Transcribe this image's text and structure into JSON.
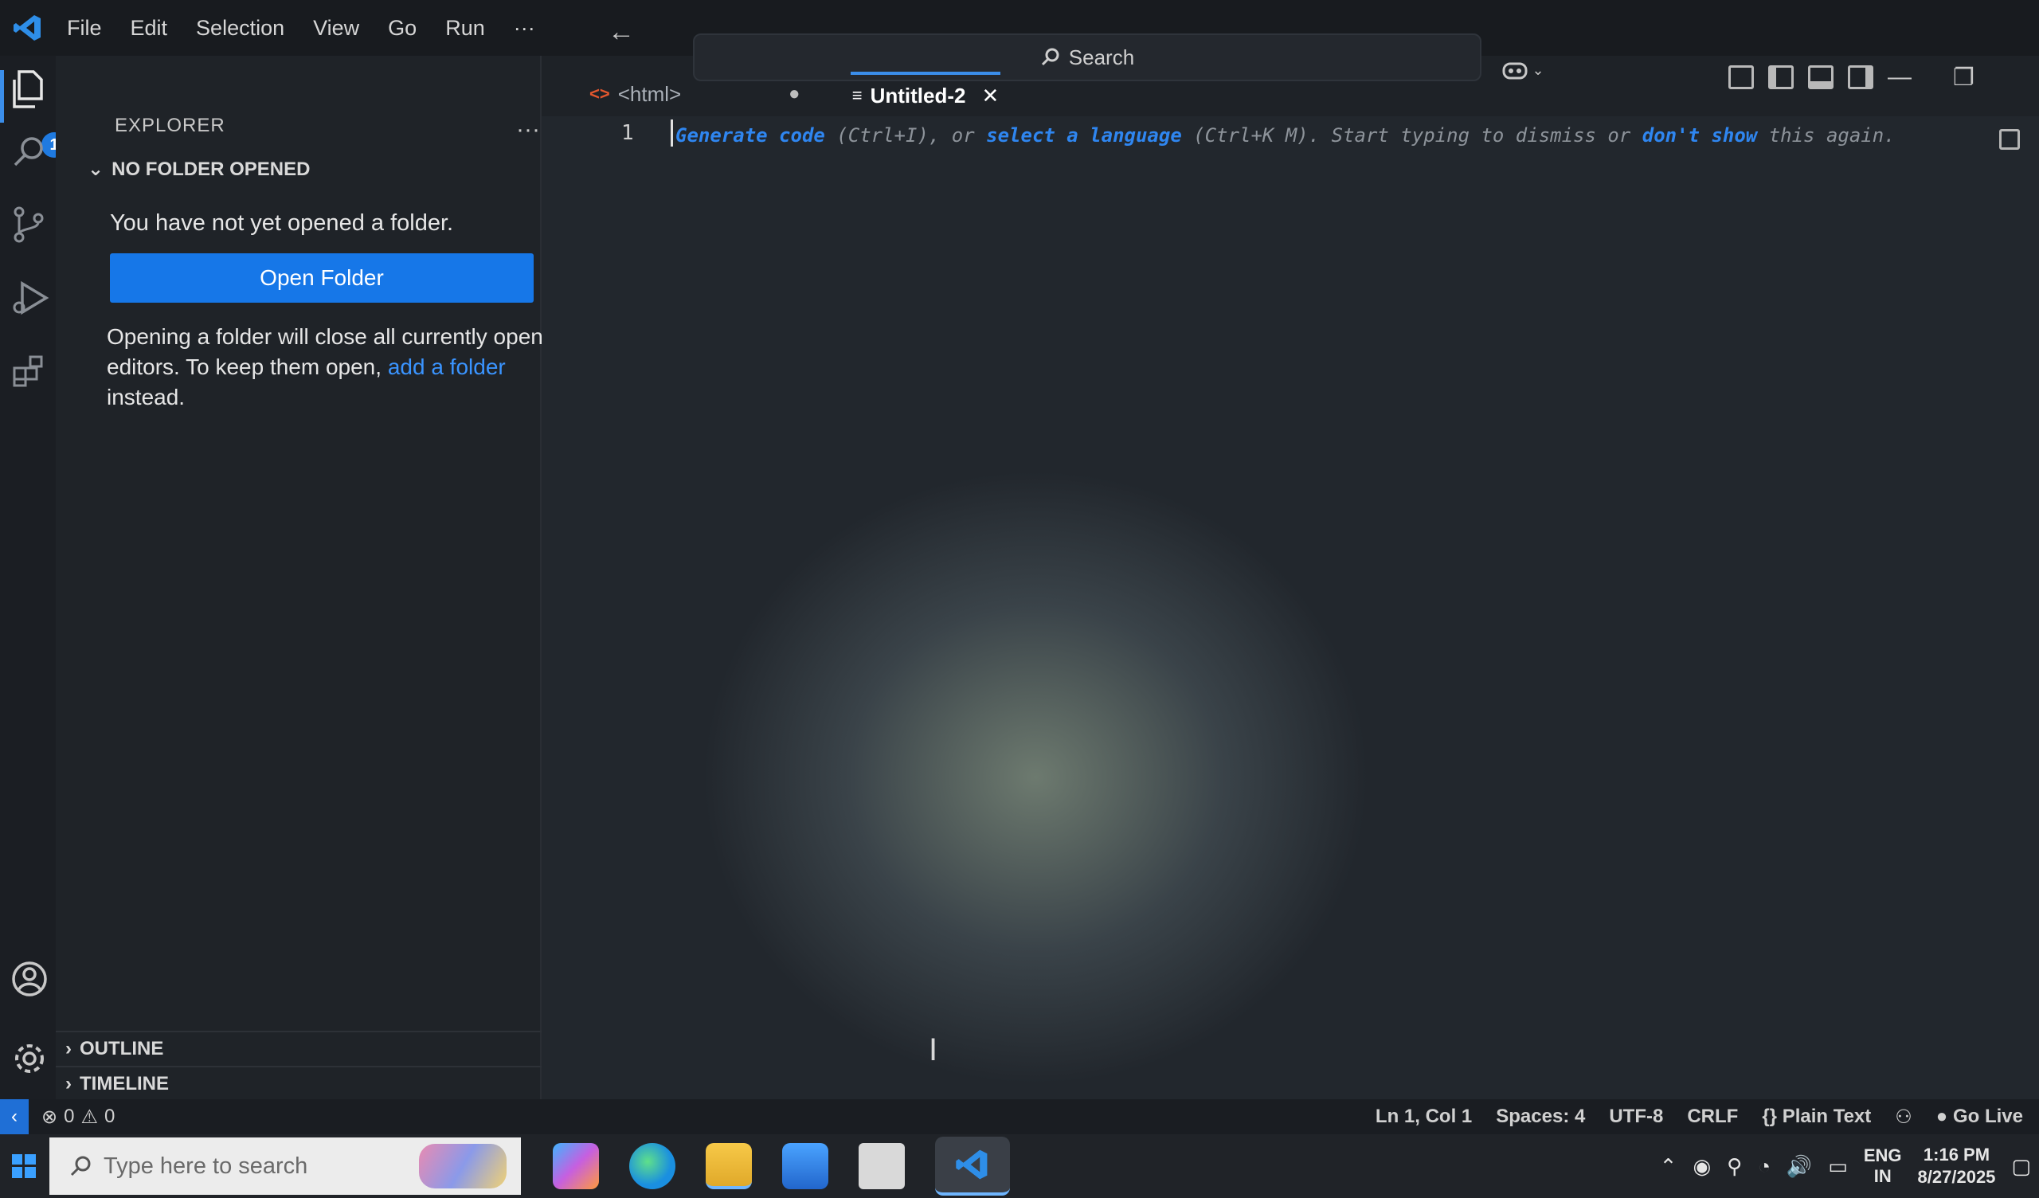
{
  "menu": [
    "File",
    "Edit",
    "Selection",
    "View",
    "Go",
    "Run",
    "···"
  ],
  "search": {
    "label": "Search"
  },
  "activity_bar": {
    "explorer_badge": "1"
  },
  "sidebar": {
    "title": "EXPLORER",
    "more": "···",
    "section_title": "NO FOLDER OPENED",
    "no_folder_text": "You have not yet opened a folder.",
    "open_folder_label": "Open Folder",
    "para_before": "Opening a folder will close all currently open editors. To keep them open, ",
    "para_link": "add a folder",
    "para_after": " instead.",
    "outline_label": "OUTLINE",
    "timeline_label": "TIMELINE"
  },
  "tabs": {
    "html_label": "<html>",
    "dot": "●",
    "active_label": "Untitled-2",
    "close": "✕"
  },
  "editor": {
    "line_number": "1",
    "hint_generate": "Generate code",
    "hint_part1": " (Ctrl+I), or ",
    "hint_select": "select a language",
    "hint_part2": " (Ctrl+K M). Start typing to dismiss or ",
    "hint_dontshow": "don't show",
    "hint_part3": " this again."
  },
  "status_bar": {
    "errors": "0",
    "warnings": "0",
    "position": "Ln 1, Col 1",
    "spaces": "Spaces: 4",
    "encoding": "UTF-8",
    "eol": "CRLF",
    "language": "Plain Text",
    "golive": "Go Live"
  },
  "taskbar": {
    "search_placeholder": "Type here to search",
    "lang_line1": "ENG",
    "lang_line2": "IN",
    "time": "1:16 PM",
    "date": "8/27/2025"
  },
  "colors": {
    "accent": "#1677e8",
    "link": "#3a94ff",
    "status_remote": "#1f6fd6"
  }
}
